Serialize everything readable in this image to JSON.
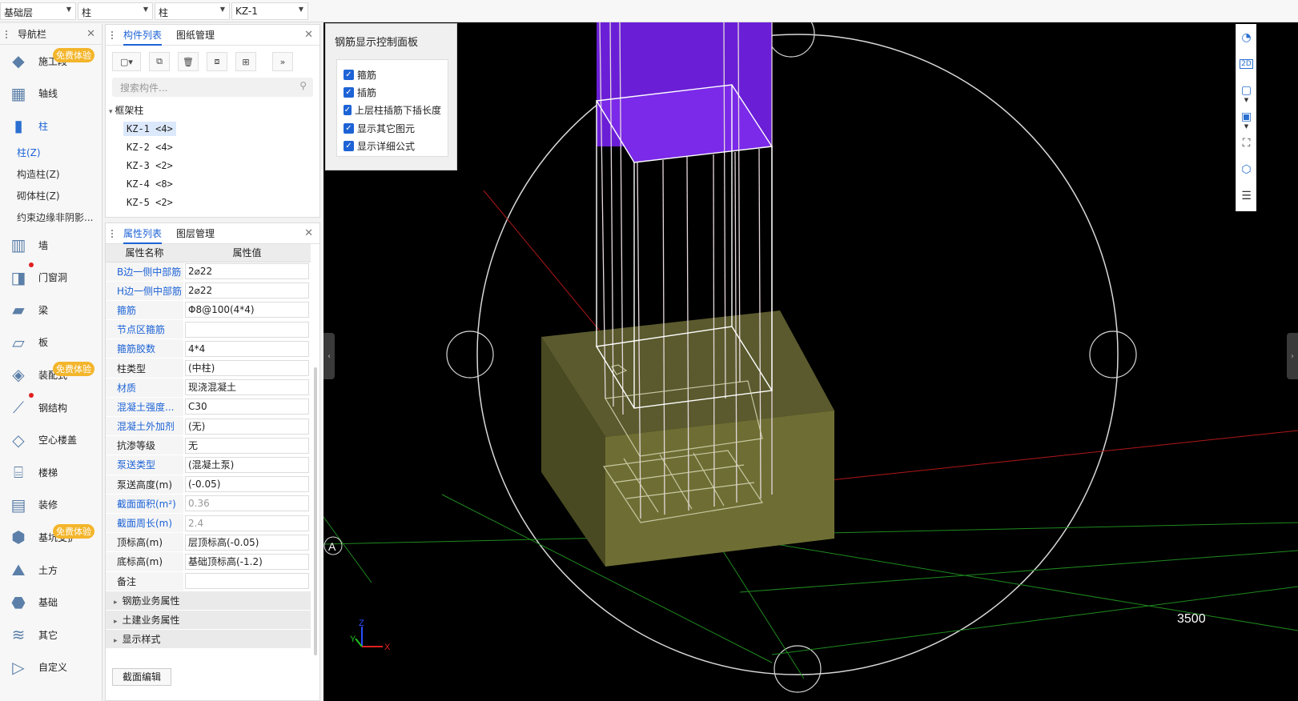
{
  "topbar": {
    "floor": "基础层",
    "category": "柱",
    "type": "柱",
    "component": "KZ-1"
  },
  "nav": {
    "title": "导航栏",
    "items": [
      {
        "label": "施工段",
        "icon": "construction-section-icon",
        "badge": "免费体验"
      },
      {
        "label": "轴线",
        "icon": "grid-icon"
      },
      {
        "label": "柱",
        "icon": "column-icon",
        "active": true
      },
      {
        "label": "墙",
        "icon": "wall-icon"
      },
      {
        "label": "门窗洞",
        "icon": "door-window-icon",
        "dot": true
      },
      {
        "label": "梁",
        "icon": "beam-icon"
      },
      {
        "label": "板",
        "icon": "slab-icon"
      },
      {
        "label": "装配式",
        "icon": "prefab-icon",
        "badge": "免费体验"
      },
      {
        "label": "钢结构",
        "icon": "steel-icon",
        "dot": true
      },
      {
        "label": "空心楼盖",
        "icon": "hollow-floor-icon"
      },
      {
        "label": "楼梯",
        "icon": "stair-icon"
      },
      {
        "label": "装修",
        "icon": "decoration-icon"
      },
      {
        "label": "基坑支护",
        "icon": "pit-support-icon",
        "badge": "免费体验"
      },
      {
        "label": "土方",
        "icon": "earthwork-icon"
      },
      {
        "label": "基础",
        "icon": "foundation-icon"
      },
      {
        "label": "其它",
        "icon": "other-icon"
      },
      {
        "label": "自定义",
        "icon": "custom-icon"
      }
    ],
    "subitems": [
      "柱(Z)",
      "构造柱(Z)",
      "砌体柱(Z)",
      "约束边缘非阴影..."
    ]
  },
  "components": {
    "tabs": [
      "构件列表",
      "图纸管理"
    ],
    "search_placeholder": "搜索构件...",
    "group": "框架柱",
    "items": [
      "KZ-1 <4>",
      "KZ-2 <4>",
      "KZ-3 <2>",
      "KZ-4 <8>",
      "KZ-5 <2>"
    ]
  },
  "properties": {
    "tabs": [
      "属性列表",
      "图层管理"
    ],
    "header": [
      "属性名称",
      "属性值"
    ],
    "rows": [
      {
        "name": "B边一侧中部筋",
        "value": "2⌀22",
        "blue": true
      },
      {
        "name": "H边一侧中部筋",
        "value": "2⌀22",
        "blue": true
      },
      {
        "name": "箍筋",
        "value": "Φ8@100(4*4)",
        "blue": true
      },
      {
        "name": "节点区箍筋",
        "value": "",
        "blue": true
      },
      {
        "name": "箍筋胶数",
        "value": "4*4",
        "blue": true
      },
      {
        "name": "柱类型",
        "value": "(中柱)"
      },
      {
        "name": "材质",
        "value": "现浇混凝土",
        "blue": true
      },
      {
        "name": "混凝土强度...",
        "value": "C30",
        "blue": true
      },
      {
        "name": "混凝土外加剂",
        "value": "(无)",
        "blue": true
      },
      {
        "name": "抗渗等级",
        "value": "无"
      },
      {
        "name": "泵送类型",
        "value": "(混凝土泵)",
        "blue": true
      },
      {
        "name": "泵送高度(m)",
        "value": "(-0.05)"
      },
      {
        "name": "截面面积(m²)",
        "value": "0.36",
        "blue": true,
        "gray": true
      },
      {
        "name": "截面周长(m)",
        "value": "2.4",
        "blue": true,
        "gray": true
      },
      {
        "name": "顶标高(m)",
        "value": "层顶标高(-0.05)"
      },
      {
        "name": "底标高(m)",
        "value": "基础顶标高(-1.2)"
      },
      {
        "name": "备注",
        "value": ""
      }
    ],
    "groups": [
      "钢筋业务属性",
      "土建业务属性",
      "显示样式"
    ],
    "bottom_button": "截面编辑"
  },
  "control_panel": {
    "title": "钢筋显示控制面板",
    "options": [
      "箍筋",
      "插筋",
      "上层柱插筋下插长度",
      "显示其它图元",
      "显示详细公式"
    ]
  },
  "viewport": {
    "axis_label": "A",
    "dimension": "3500",
    "triad": {
      "z": "Z",
      "y": "Y",
      "x": "X"
    }
  }
}
